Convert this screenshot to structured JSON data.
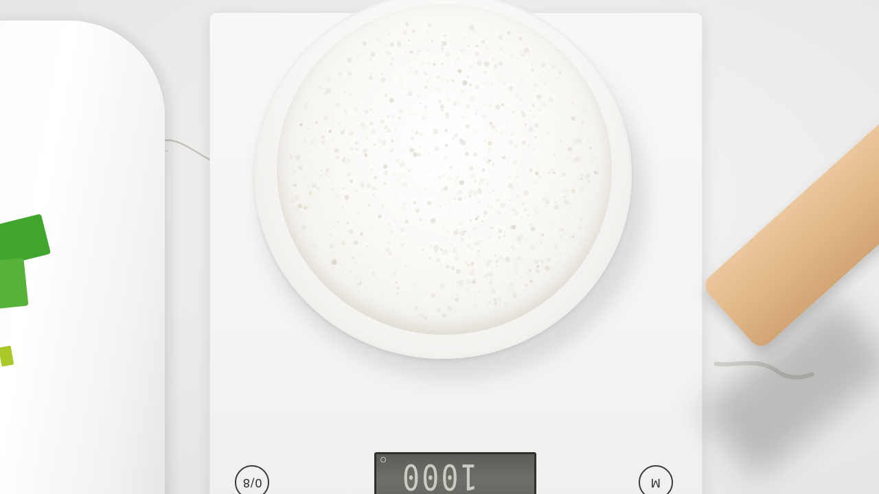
{
  "scene": {
    "background_color": "#ecebea",
    "objects": [
      "flour-bag",
      "kitchen-scale",
      "bowl-of-flour",
      "rolling-pin"
    ]
  },
  "scale": {
    "display_reading": "1000",
    "left_button_label": "0/8",
    "right_button_label": "M",
    "body_color": "#f4f4f3",
    "display_color": "#62665f"
  },
  "bag": {
    "label_color": "#3fa52c",
    "label_color_secondary": "#58b13a"
  },
  "rolling_pin": {
    "color": "#e1b988"
  }
}
